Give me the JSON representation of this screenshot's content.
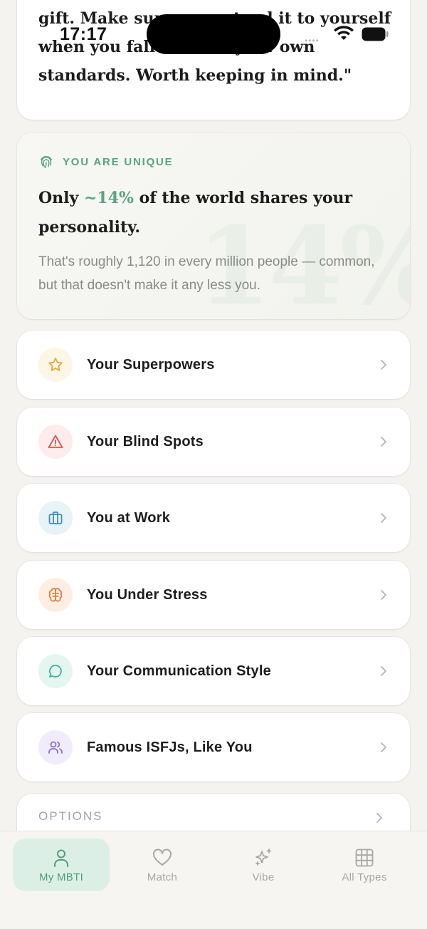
{
  "status_bar": {
    "time": "17:17"
  },
  "quote": {
    "text": "\"Your patience with others is a genuine gift. Make sure you extend it to yourself when you fall short of your own standards. Worth keeping in mind.\""
  },
  "unique": {
    "label": "YOU ARE UNIQUE",
    "title_prefix": "Only ",
    "title_accent": "~14%",
    "title_suffix": " of the world shares your personality.",
    "subtitle": "That's roughly 1,120 in every million people — common, but that doesn't make it any less you.",
    "watermark": "14%",
    "accent_color": "#5aa381"
  },
  "sections": [
    {
      "label": "Your Superpowers",
      "icon": "star-icon",
      "color": "#e2a93b",
      "bg": "#fdf5e6"
    },
    {
      "label": "Your Blind Spots",
      "icon": "warning-icon",
      "color": "#d9534f",
      "bg": "#fdecec"
    },
    {
      "label": "You at Work",
      "icon": "briefcase-icon",
      "color": "#3d8fb8",
      "bg": "#e8f3f8"
    },
    {
      "label": "You Under Stress",
      "icon": "brain-icon",
      "color": "#e27c38",
      "bg": "#fdeee4"
    },
    {
      "label": "Your Communication Style",
      "icon": "chat-bubble-icon",
      "color": "#3bb39a",
      "bg": "#e5f6f1"
    },
    {
      "label": "Famous ISFJs, Like You",
      "icon": "users-icon",
      "color": "#8a6fd1",
      "bg": "#f1ecfb"
    }
  ],
  "options": {
    "label": "OPTIONS"
  },
  "tabs": [
    {
      "label": "My MBTI",
      "icon": "person-icon",
      "active": true
    },
    {
      "label": "Match",
      "icon": "heart-icon",
      "active": false
    },
    {
      "label": "Vibe",
      "icon": "sparkles-icon",
      "active": false
    },
    {
      "label": "All Types",
      "icon": "grid-icon",
      "active": false
    }
  ]
}
